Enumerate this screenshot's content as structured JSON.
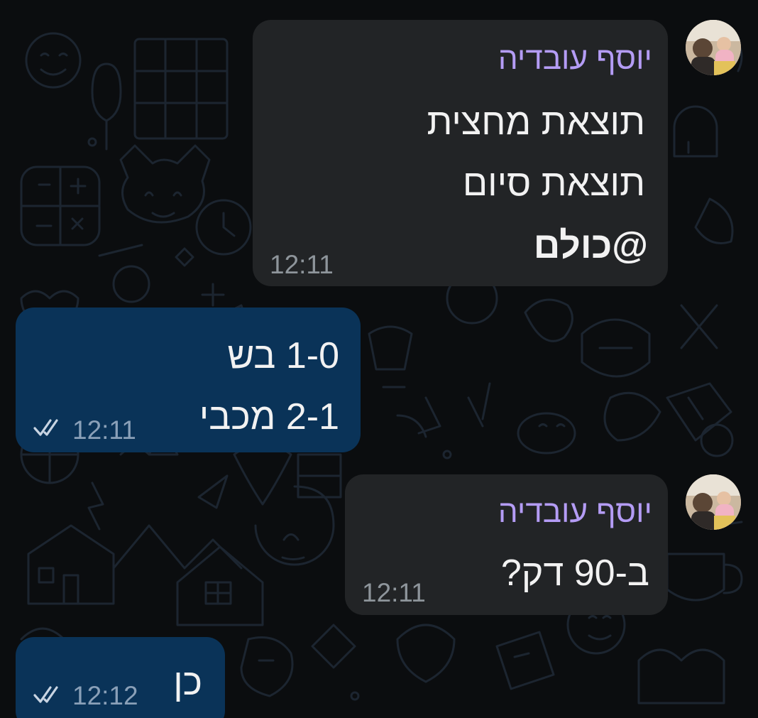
{
  "messages": [
    {
      "direction": "incoming",
      "sender": "יוסף עובדיה",
      "lines": [
        "תוצאת מחצית",
        "תוצאת סיום"
      ],
      "mention": "@כולם",
      "time": "12:11"
    },
    {
      "direction": "outgoing",
      "lines": [
        "1-0 בש",
        "2-1 מכבי"
      ],
      "time": "12:11",
      "status": "read-double-check-icon"
    },
    {
      "direction": "incoming",
      "sender": "יוסף עובדיה",
      "lines": [
        "ב-90 דק?"
      ],
      "time": "12:11"
    },
    {
      "direction": "outgoing",
      "lines": [
        "כן"
      ],
      "time": "12:12",
      "status": "read-double-check-icon"
    }
  ],
  "colors": {
    "background": "#0b0d0f",
    "incoming_bubble": "#222426",
    "outgoing_bubble": "#0a3358",
    "sender_name": "#b49cf5",
    "message_text": "#f2f2f2",
    "timestamp": "#8e959b"
  }
}
